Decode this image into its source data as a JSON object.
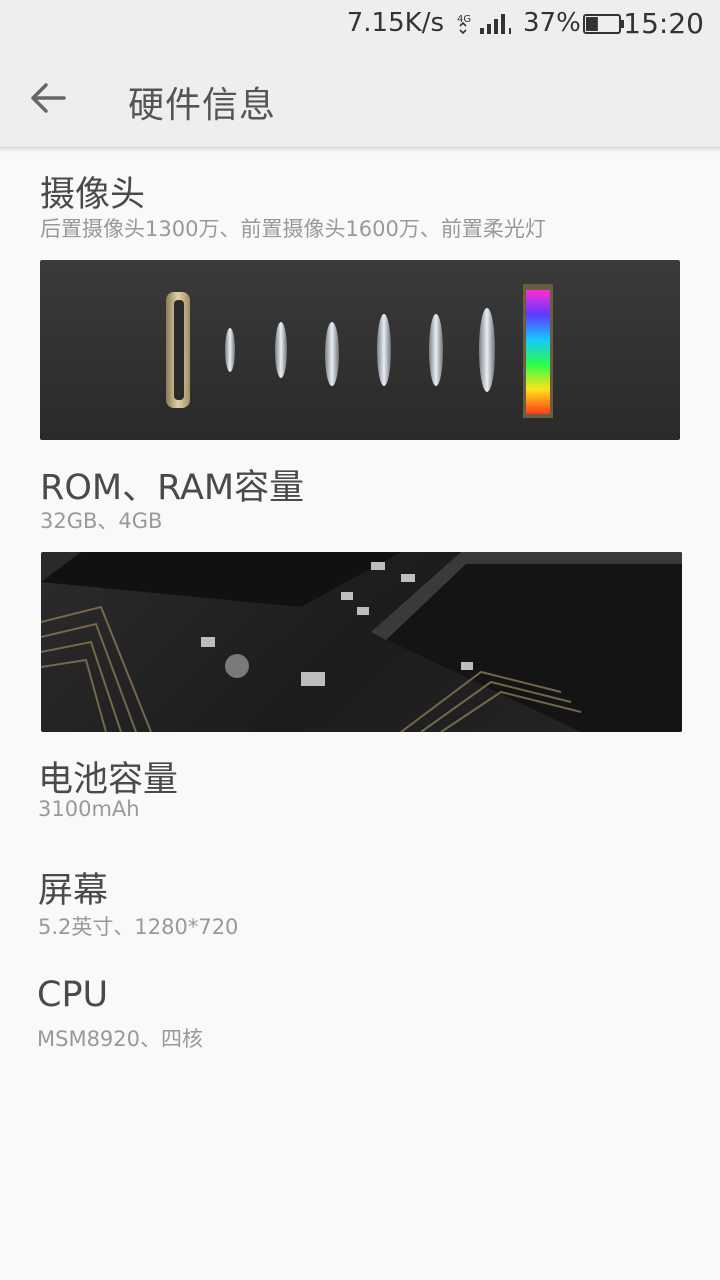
{
  "status_bar": {
    "net_speed": "7.15K/s",
    "network_type": "4G",
    "battery_percent": "37%",
    "battery_level": 0.37,
    "time": "15:20"
  },
  "toolbar": {
    "title": "硬件信息",
    "back_icon": "arrow-left-icon"
  },
  "sections": [
    {
      "title": "摄像头",
      "detail": "后置摄像头1300万、前置摄像头1600万、前置柔光灯"
    },
    {
      "title": "ROM、RAM容量",
      "detail": "32GB、4GB"
    },
    {
      "title": "电池容量",
      "detail": "3100mAh"
    },
    {
      "title": "屏幕",
      "detail": "5.2英寸、1280*720"
    },
    {
      "title": "CPU",
      "detail": "MSM8920、四核"
    }
  ],
  "colors": {
    "background": "#f9f9f9",
    "toolbar": "#eeeeee",
    "title_text": "#4a4a4a",
    "detail_text": "#999999"
  }
}
